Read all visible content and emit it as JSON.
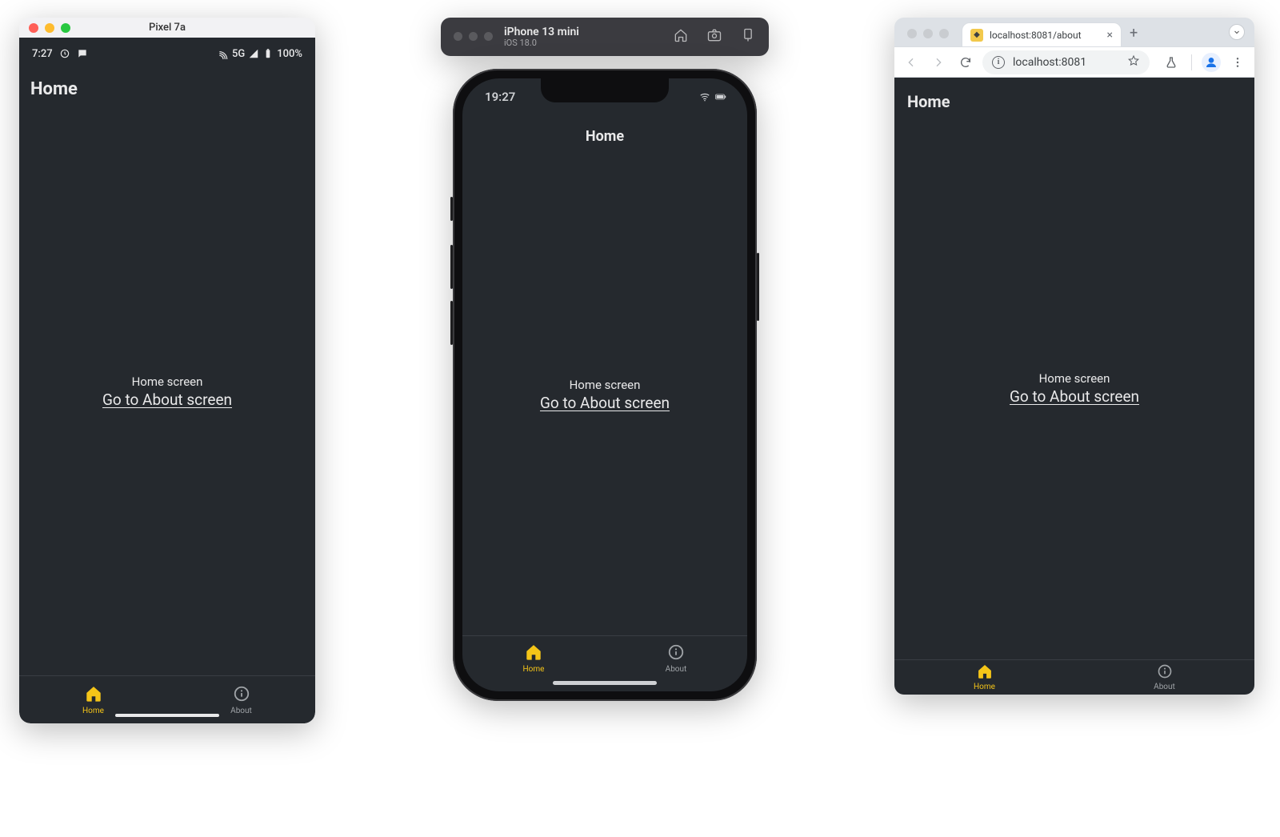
{
  "android": {
    "window_title": "Pixel 7a",
    "status": {
      "time": "7:27",
      "network_label": "5G",
      "battery_label": "100%"
    },
    "header": "Home",
    "content": {
      "label": "Home screen",
      "link_text": "Go to About screen"
    },
    "tabs": {
      "home": "Home",
      "about": "About"
    }
  },
  "ios": {
    "devbar": {
      "device_name": "iPhone 13 mini",
      "os": "iOS 18.0"
    },
    "status": {
      "time": "19:27"
    },
    "header": "Home",
    "content": {
      "label": "Home screen",
      "link_text": "Go to About screen"
    },
    "tabs": {
      "home": "Home",
      "about": "About"
    }
  },
  "web": {
    "tab_title": "localhost:8081/about",
    "url": "localhost:8081",
    "header": "Home",
    "content": {
      "label": "Home screen",
      "link_text": "Go to About screen"
    },
    "tabs": {
      "home": "Home",
      "about": "About"
    }
  }
}
